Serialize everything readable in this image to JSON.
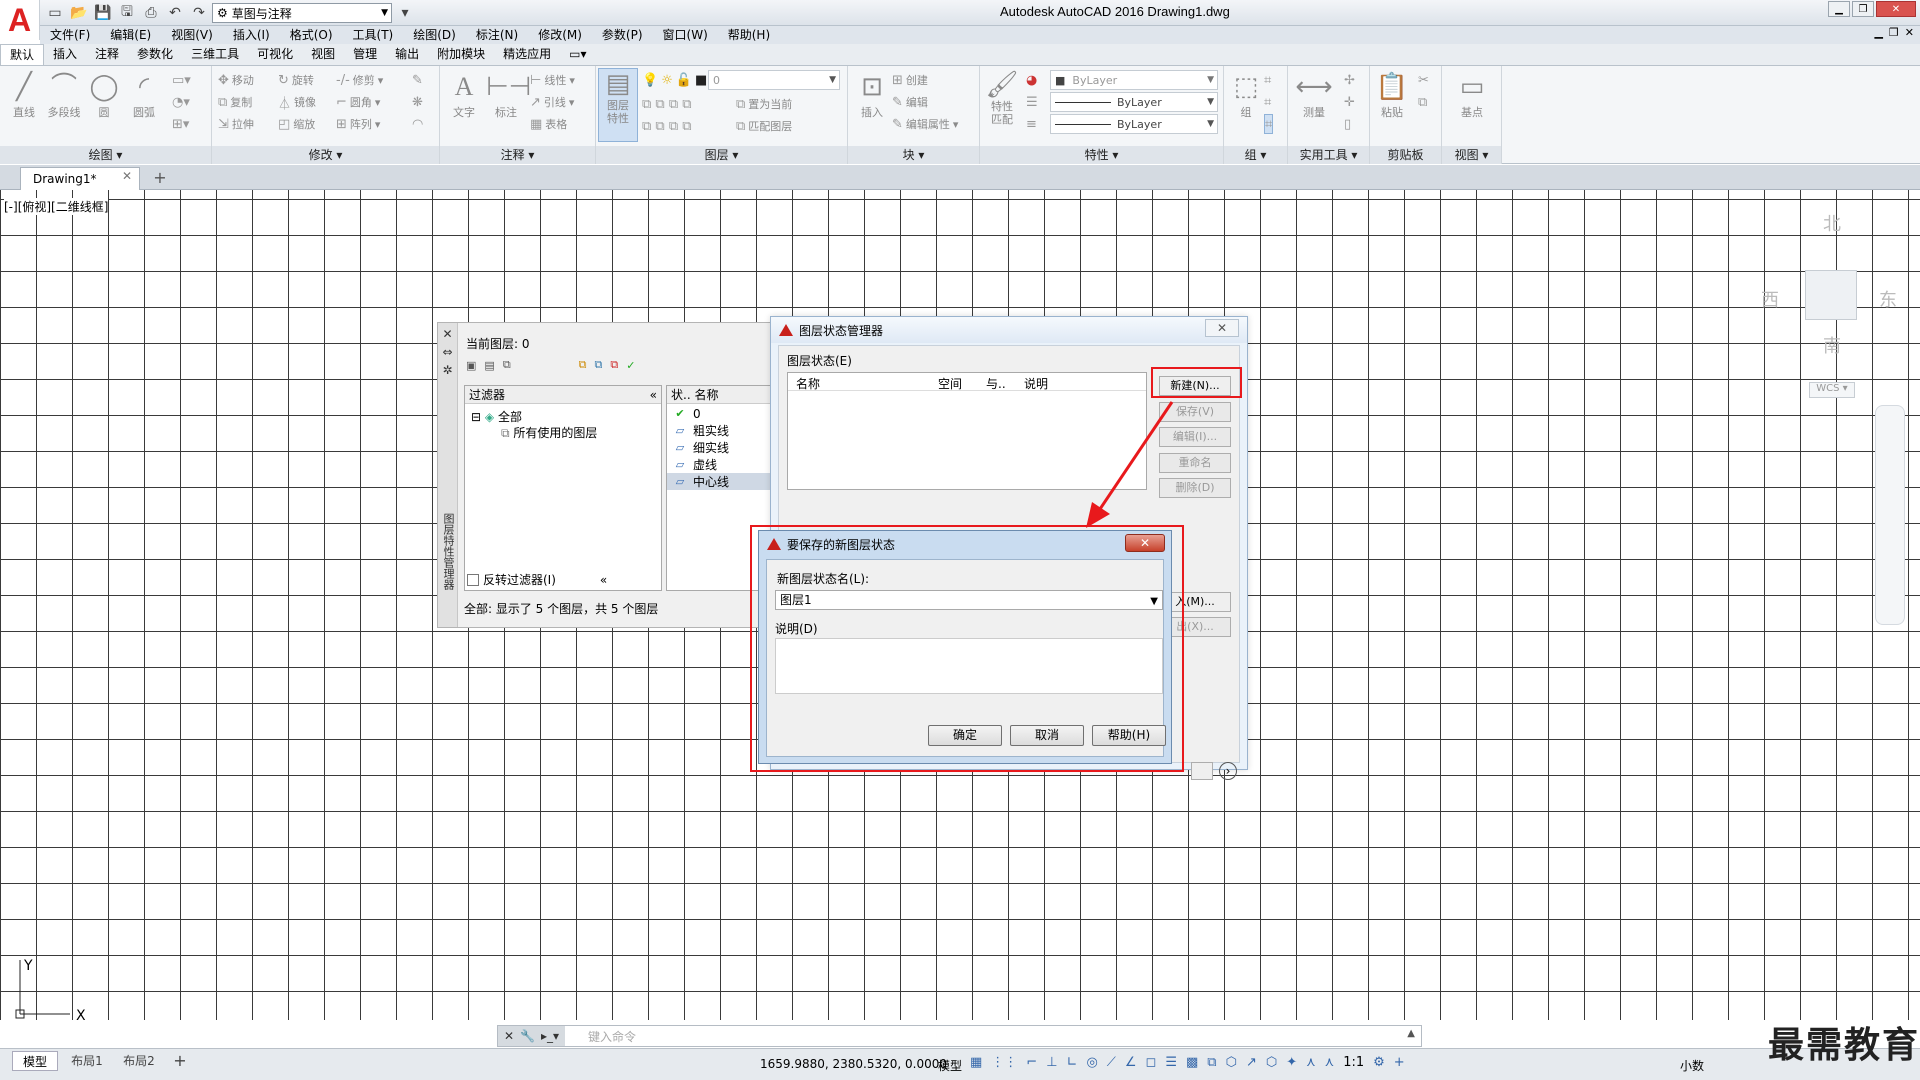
{
  "window": {
    "title": "Autodesk AutoCAD 2016    Drawing1.dwg",
    "workspace": "草图与注释",
    "logo": "A"
  },
  "menu": [
    "文件(F)",
    "编辑(E)",
    "视图(V)",
    "插入(I)",
    "格式(O)",
    "工具(T)",
    "绘图(D)",
    "标注(N)",
    "修改(M)",
    "参数(P)",
    "窗口(W)",
    "帮助(H)"
  ],
  "ribbon_tabs": [
    "默认",
    "插入",
    "注释",
    "参数化",
    "三维工具",
    "可视化",
    "视图",
    "管理",
    "输出",
    "附加模块",
    "精选应用"
  ],
  "ribbon": {
    "draw": {
      "title": "绘图",
      "line": "直线",
      "polyline": "多段线",
      "circle": "圆",
      "arc": "圆弧"
    },
    "modify": {
      "title": "修改",
      "move": "移动",
      "rotate": "旋转",
      "trim": "修剪",
      "copy": "复制",
      "mirror": "镜像",
      "fillet": "圆角",
      "stretch": "拉伸",
      "scale": "缩放",
      "array": "阵列"
    },
    "annotation": {
      "title": "注释",
      "text": "文字",
      "dimension": "标注",
      "linear": "线性",
      "leader": "引线",
      "table": "表格"
    },
    "layers": {
      "title": "图层",
      "properties": "图层\n特性",
      "current_layer": "0",
      "set_current": "置为当前",
      "match_layer": "匹配图层"
    },
    "block": {
      "title": "块",
      "insert": "插入",
      "create": "创建",
      "edit": "编辑",
      "edit_attr": "编辑属性"
    },
    "properties": {
      "title": "特性",
      "match": "特性\n匹配",
      "color": "ByLayer",
      "linetype": "ByLayer",
      "lineweight": "ByLayer"
    },
    "group": {
      "title": "组",
      "group": "组"
    },
    "utilities": {
      "title": "实用工具",
      "measure": "测量"
    },
    "clipboard": {
      "title": "剪贴板",
      "paste": "粘贴"
    },
    "view": {
      "title": "视图",
      "base": "基点"
    }
  },
  "doc_tab": "Drawing1*",
  "viewport_label": "[-][俯视][二维线框]",
  "viewcube": {
    "north": "北",
    "south": "南",
    "east": "东",
    "west": "西",
    "wcs": "WCS ▾"
  },
  "ucs": {
    "x": "X",
    "y": "Y"
  },
  "layer_palette": {
    "vertical_title": "图层特性管理器",
    "current_layer": "当前图层: 0",
    "filter_header": "过滤器",
    "filter_all": "全部",
    "filter_used": "所有使用的图层",
    "invert_filter": "反转过滤器(I)",
    "list_header": "状.. 名称",
    "layers": [
      "0",
      "粗实线",
      "细实线",
      "虚线",
      "中心线"
    ],
    "status": "全部: 显示了 5 个图层，共 5 个图层"
  },
  "layer_state_manager": {
    "title": "图层状态管理器",
    "group_label": "图层状态(E)",
    "columns": [
      "名称",
      "空间",
      "与..",
      "说明"
    ],
    "buttons": {
      "new": "新建(N)...",
      "save": "保存(V)",
      "edit": "编辑(I)...",
      "rename": "重命名",
      "delete": "删除(D)",
      "import": "入(M)...",
      "export": "出(X)..."
    }
  },
  "new_state_dialog": {
    "title": "要保存的新图层状态",
    "name_label": "新图层状态名(L):",
    "name_value": "图层1",
    "desc_label": "说明(D)",
    "ok": "确定",
    "cancel": "取消",
    "help": "帮助(H)"
  },
  "command_line": {
    "placeholder": "键入命令"
  },
  "status_bar": {
    "layout_tabs": [
      "模型",
      "布局1",
      "布局2"
    ],
    "coords": "1659.9880, 2380.5320, 0.0000",
    "model": "模型",
    "scale": "1:1",
    "units": "小数"
  },
  "watermark": "最需教育",
  "colors": {
    "annotation_red": "#e8191c",
    "autocad_red": "#c8201b",
    "selection": "#cfd8e4"
  }
}
